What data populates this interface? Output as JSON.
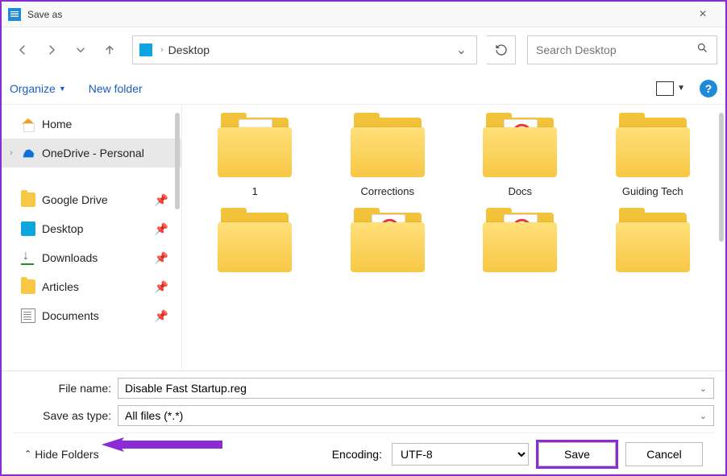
{
  "title": "Save as",
  "path": {
    "location": "Desktop"
  },
  "search": {
    "placeholder": "Search Desktop"
  },
  "toolbar": {
    "organize": "Organize",
    "newfolder": "New folder"
  },
  "sidebar": [
    {
      "label": "Home",
      "icon": "home",
      "expand": "",
      "pin": false,
      "sel": false
    },
    {
      "label": "OneDrive - Personal",
      "icon": "cloud",
      "expand": "›",
      "pin": false,
      "sel": true
    },
    {
      "label": "Google Drive",
      "icon": "fold",
      "expand": "",
      "pin": true,
      "sel": false
    },
    {
      "label": "Desktop",
      "icon": "desk",
      "expand": "",
      "pin": true,
      "sel": false
    },
    {
      "label": "Downloads",
      "icon": "down",
      "expand": "",
      "pin": true,
      "sel": false
    },
    {
      "label": "Articles",
      "icon": "fold",
      "expand": "",
      "pin": true,
      "sel": false
    },
    {
      "label": "Documents",
      "icon": "doc",
      "expand": "",
      "pin": true,
      "sel": false
    }
  ],
  "folders": [
    {
      "name": "1",
      "inner": "gear"
    },
    {
      "name": "Corrections",
      "inner": ""
    },
    {
      "name": "Docs",
      "inner": "pdf"
    },
    {
      "name": "Guiding Tech",
      "inner": ""
    },
    {
      "name": "",
      "inner": ""
    },
    {
      "name": "",
      "inner": "pdf"
    },
    {
      "name": "",
      "inner": "pdf"
    },
    {
      "name": "",
      "inner": "img2"
    }
  ],
  "filename_label": "File name:",
  "filename": "Disable Fast Startup.reg",
  "saveastype_label": "Save as type:",
  "saveastype": "All files  (*.*)",
  "hide_folders": "Hide Folders",
  "encoding_label": "Encoding:",
  "encoding": "UTF-8",
  "save_label": "Save",
  "cancel_label": "Cancel"
}
